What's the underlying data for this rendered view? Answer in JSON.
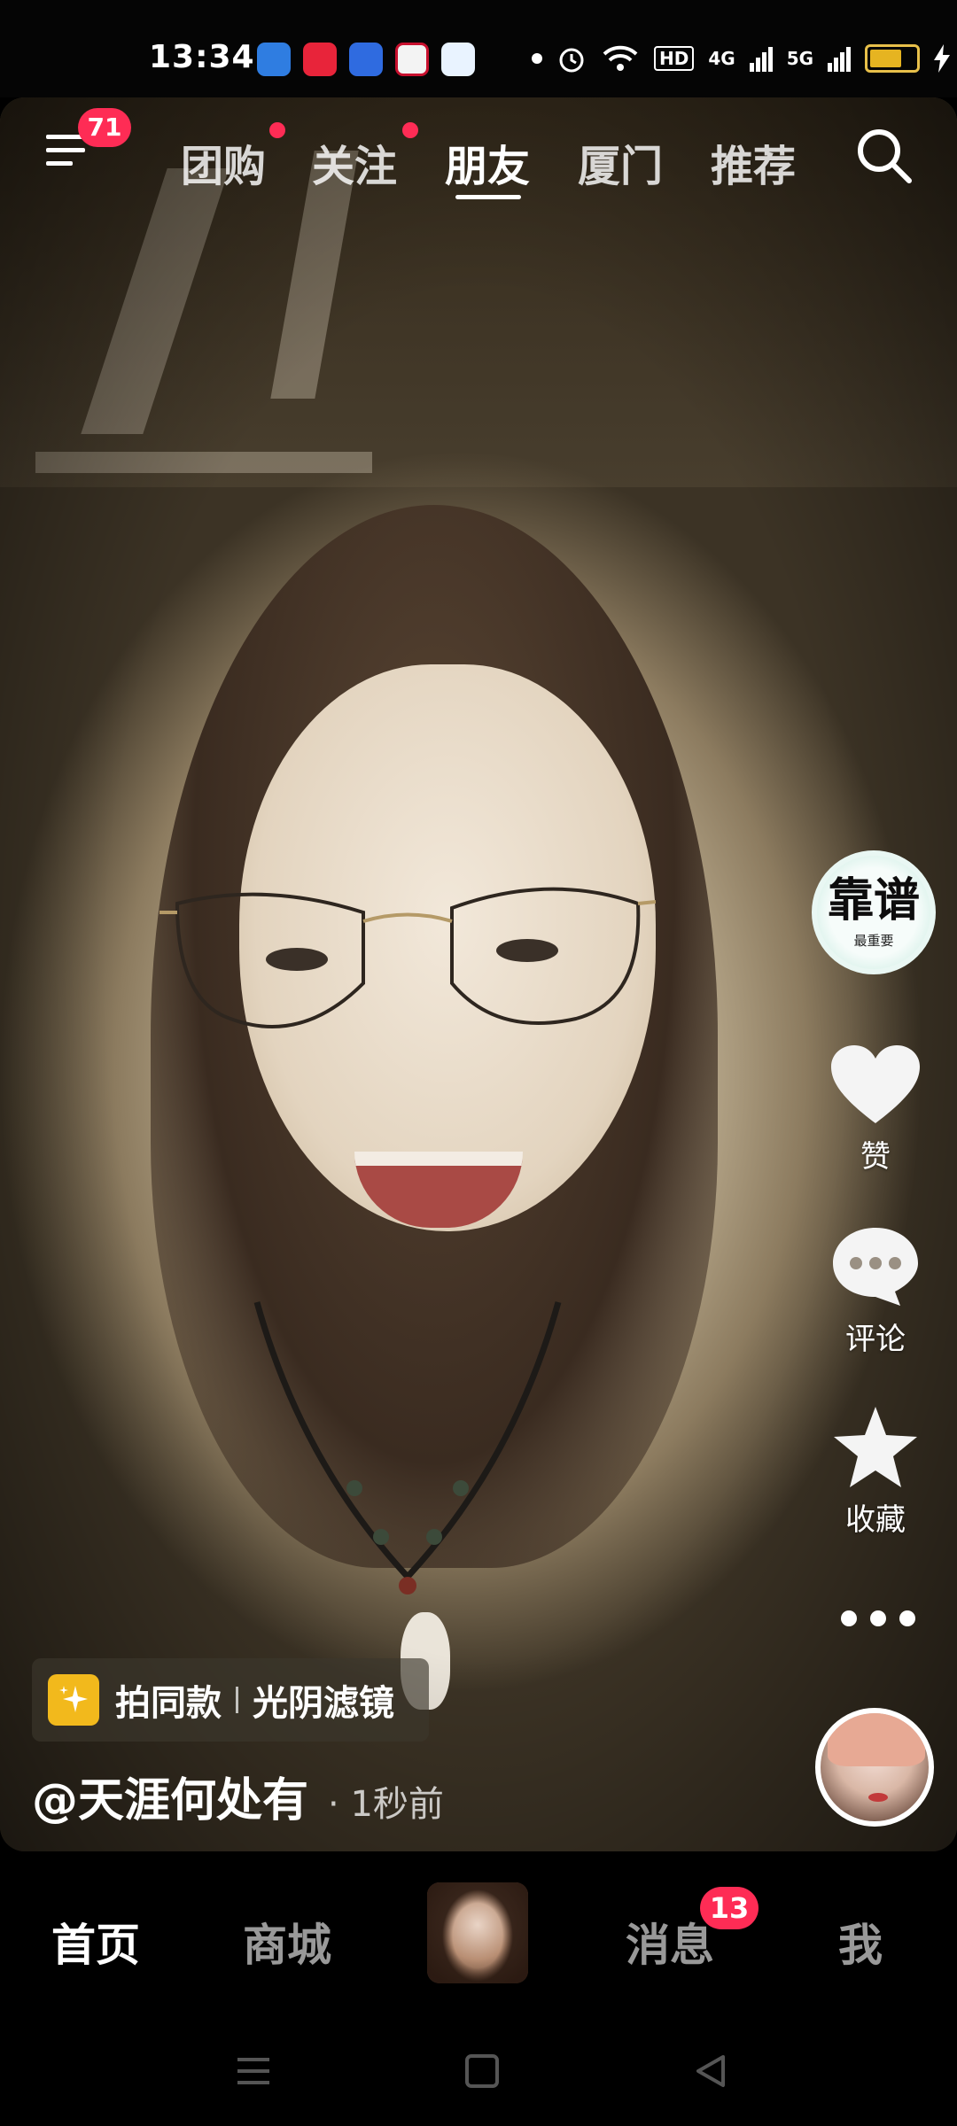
{
  "status_bar": {
    "time": "13:34",
    "network_4g": "4G",
    "network_5g": "5G",
    "hd_label": "HD",
    "battery_level": 0.8,
    "app_icons": [
      "blue-app-icon",
      "xiaohongshu-icon",
      "baidu-icon",
      "bank-icon",
      "search-app-icon"
    ]
  },
  "top_nav": {
    "menu_badge": "71",
    "tabs": [
      {
        "label": "团购",
        "dot": true
      },
      {
        "label": "关注",
        "dot": true
      },
      {
        "label": "朋友",
        "active": true
      },
      {
        "label": "厦门"
      },
      {
        "label": "推荐"
      }
    ]
  },
  "side_actions": {
    "avatar_text": "靠谱",
    "avatar_subtext": "最重要",
    "like_label": "赞",
    "comment_label": "评论",
    "favorite_label": "收藏"
  },
  "video_info": {
    "template_label": "拍同款",
    "filter_label": "光阴滤镜",
    "author": "@天涯何处有",
    "time": "· 1秒前"
  },
  "bottom_nav": {
    "home": "首页",
    "mall": "商城",
    "messages": "消息",
    "messages_badge": "13",
    "me": "我"
  },
  "colors": {
    "accent_red": "#fe2c55",
    "template_icon": "#f2b91c"
  }
}
